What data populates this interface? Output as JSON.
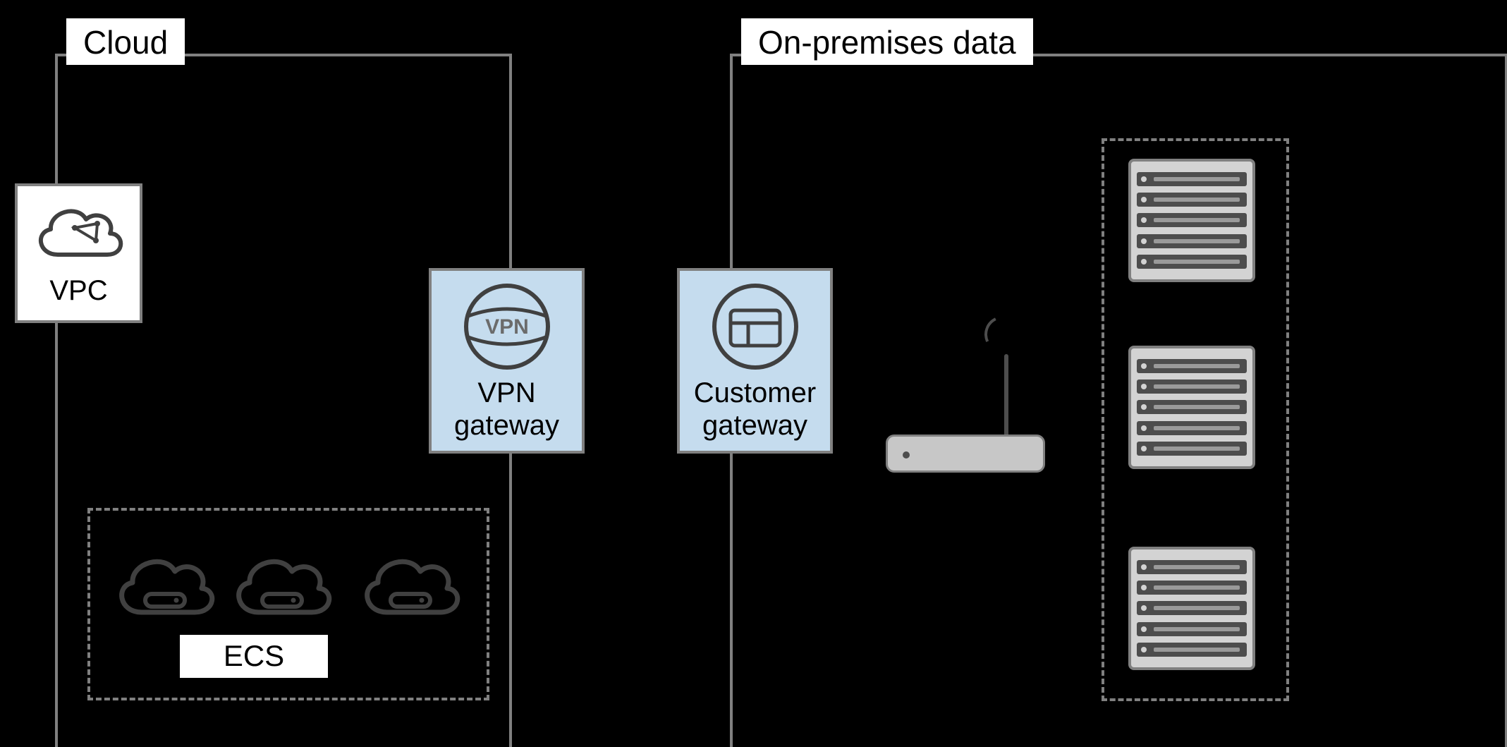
{
  "regions": {
    "cloud": {
      "label": "Cloud"
    },
    "onprem": {
      "label": "On-premises data"
    }
  },
  "nodes": {
    "vpc": {
      "label": "VPC"
    },
    "vpn_gateway": {
      "label_line1": "VPN",
      "label_line2": "gateway"
    },
    "customer_gateway": {
      "label_line1": "Customer",
      "label_line2": "gateway"
    }
  },
  "groups": {
    "ecs": {
      "label": "ECS"
    }
  },
  "icons": {
    "vpc": "vpc-cloud-icon",
    "vpn": "vpn-circle-icon",
    "customer_gateway": "gateway-window-icon",
    "ecs": "ecs-cloud-icon",
    "router": "router-icon",
    "rack": "server-rack-icon"
  }
}
